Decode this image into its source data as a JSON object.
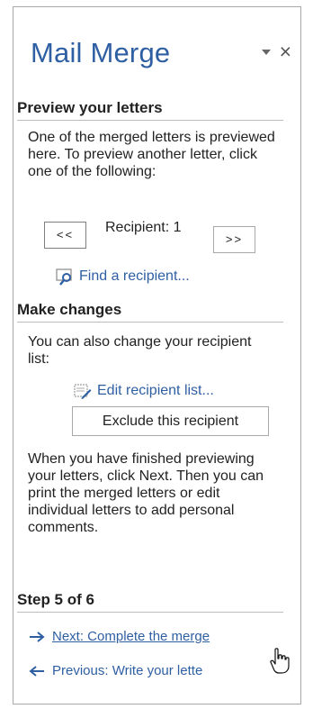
{
  "pane": {
    "title": "Mail Merge",
    "controls": {
      "dropdown_icon": "triangle-down-icon",
      "close_label": "×"
    }
  },
  "preview": {
    "heading": "Preview your letters",
    "description": "One of the merged letters is previewed here. To preview another letter, click one of the following:",
    "prev_label": "<<",
    "next_label": ">>",
    "recipient_label": "Recipient: 1",
    "find_label": "Find a recipient..."
  },
  "changes": {
    "heading": "Make changes",
    "description": "You can also change your recipient list:",
    "edit_list_label": "Edit recipient list...",
    "exclude_label": "Exclude this recipient",
    "finish_text": "When you have finished previewing your letters, click Next. Then you can print the merged letters or edit individual letters to add personal comments."
  },
  "steps": {
    "heading": "Step 5 of 6",
    "next_label": "Next: Complete the merge",
    "previous_label": "Previous: Write your lette"
  },
  "colors": {
    "accent": "#2f5fa3",
    "border": "#a8a8a8",
    "text": "#222222"
  }
}
